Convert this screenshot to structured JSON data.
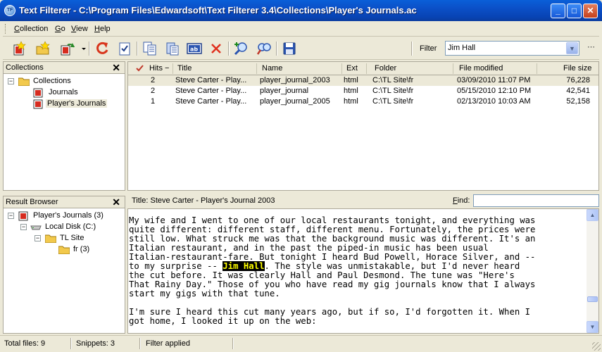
{
  "window": {
    "title": "Text Filterer - C:\\Program Files\\Edwardsoft\\Text Filterer 3.4\\Collections\\Player's Journals.ac",
    "app_icon_text": "TF",
    "minimize": "_",
    "maximize": "□",
    "close": "✕"
  },
  "menu": {
    "collection_u": "C",
    "collection_rest": "ollection",
    "go_u": "G",
    "go_rest": "o",
    "view_u": "V",
    "view_rest": "iew",
    "help_u": "H",
    "help_rest": "elp"
  },
  "toolbar": {
    "icons": [
      "new-collection-icon",
      "open-folder-icon",
      "refresh-collection-icon",
      "reload-icon",
      "check-document-icon",
      "copy-document-icon",
      "paste-document-icon",
      "rename-icon",
      "delete-icon",
      "find-add-icon",
      "find-icon",
      "save-icon"
    ],
    "filter_label": "Filter",
    "filter_value": "Jim Hall",
    "more": "⋯",
    "drop_arrow": "▼"
  },
  "colors": {
    "accent": "#0b4fc7",
    "highlight_bg": "#000000",
    "highlight_fg": "#ffff00",
    "delete": "#e0301e",
    "reload": "#d8351c"
  },
  "collections_panel": {
    "title": "Collections",
    "close": "✕",
    "tree": [
      {
        "label": "Collections",
        "type": "folder",
        "expander": "−"
      },
      {
        "label": "Journals",
        "type": "collection"
      },
      {
        "label": "Player's Journals",
        "type": "collection",
        "selected": true
      }
    ]
  },
  "results": {
    "columns": {
      "hits": "Hits",
      "sort": "−",
      "title": "Title",
      "name": "Name",
      "ext": "Ext",
      "folder": "Folder",
      "modified": "File modified",
      "size": "File size"
    },
    "rows": [
      {
        "hits": "2",
        "title": "Steve Carter - Play...",
        "name": "player_journal_2003",
        "ext": "html",
        "folder": "C:\\TL Site\\fr",
        "modified": "03/09/2010 11:07 PM",
        "size": "76,228"
      },
      {
        "hits": "2",
        "title": "Steve Carter - Play...",
        "name": "player_journal",
        "ext": "html",
        "folder": "C:\\TL Site\\fr",
        "modified": "05/15/2010 12:10 PM",
        "size": "42,541"
      },
      {
        "hits": "1",
        "title": "Steve Carter - Play...",
        "name": "player_journal_2005",
        "ext": "html",
        "folder": "C:\\TL Site\\fr",
        "modified": "02/13/2010 10:03 AM",
        "size": "52,158"
      }
    ]
  },
  "result_browser": {
    "title": "Result Browser",
    "close": "✕",
    "tree": [
      {
        "label": "Player's Journals (3)",
        "expander": "−"
      },
      {
        "label": "Local Disk (C:)",
        "expander": "−"
      },
      {
        "label": "TL Site",
        "expander": "−"
      },
      {
        "label": "fr (3)"
      }
    ]
  },
  "preview": {
    "title": "Title: Steve Carter - Player's Journal 2003",
    "find_label": "Find:",
    "find_value": "",
    "lines": [
      "My wife and I went to one of our local restaurants tonight, and everything was",
      "quite different: different staff, different menu. Fortunately, the prices were",
      "still low. What struck me was that the background music was different. It's an",
      "Italian restaurant, and in the past the piped-in music has been usual",
      "Italian-restaurant-fare. But tonight I heard Bud Powell, Horace Silver, and --"
    ],
    "line6_before": "to my surprise -- ",
    "line6_highlight": "Jim Hall",
    "line6_after": ". The style was unmistakable, but I'd never heard",
    "lines_after": [
      "the cut before. It was clearly Hall and Paul Desmond. The tune was \"Here's",
      "That Rainy Day.\" Those of you who have read my gig journals know that I always",
      "start my gigs with that tune.",
      "",
      "I'm sure I heard this cut many years ago, but if so, I'd forgotten it. When I",
      "got home, I looked it up on the web:"
    ],
    "scroll_up": "▲",
    "scroll_down": "▼"
  },
  "status": {
    "total_files": "Total files: 9",
    "snippets": "Snippets: 3",
    "filter_state": "Filter applied"
  }
}
